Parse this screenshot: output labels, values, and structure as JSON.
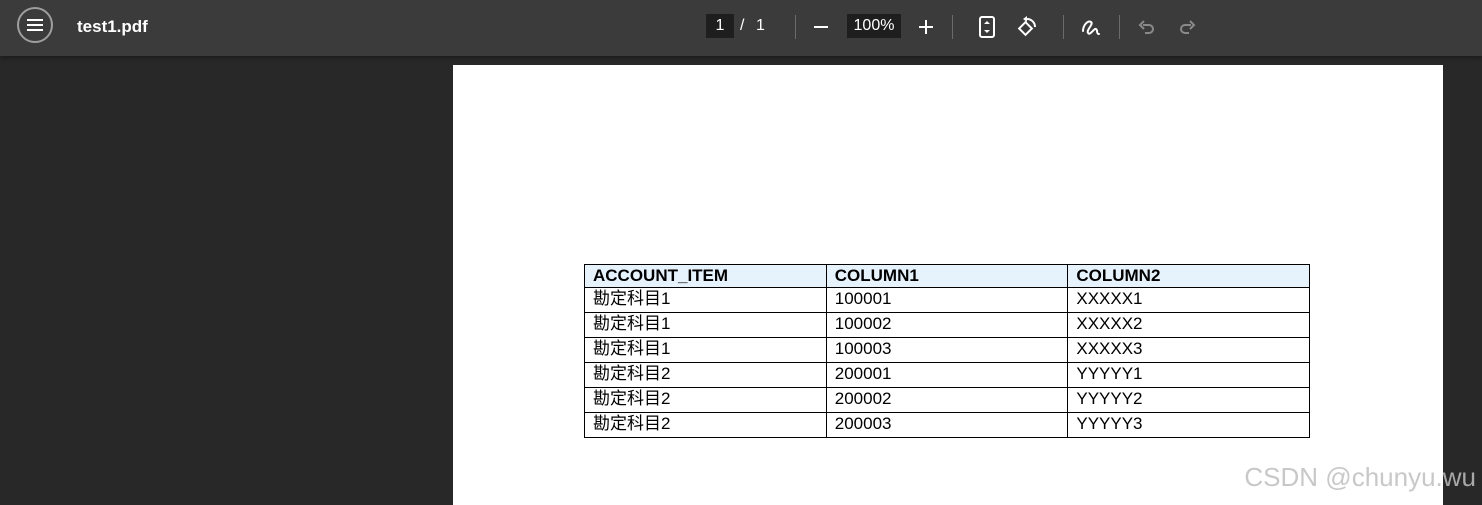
{
  "toolbar": {
    "title": "test1.pdf",
    "page_current": "1",
    "page_separator": "/",
    "page_total": "1",
    "zoom": "100%"
  },
  "icons": {
    "menu": "menu-icon",
    "zoom_out": "minus-icon",
    "zoom_in": "plus-icon",
    "fit": "fit-page-icon",
    "rotate": "rotate-icon",
    "annotate": "pen-icon",
    "undo": "undo-icon",
    "redo": "redo-icon"
  },
  "document": {
    "table": {
      "headers": [
        "ACCOUNT_ITEM",
        "COLUMN1",
        "COLUMN2"
      ],
      "rows": [
        [
          "勘定科目1",
          "100001",
          "XXXXX1"
        ],
        [
          "勘定科目1",
          "100002",
          "XXXXX2"
        ],
        [
          "勘定科目1",
          "100003",
          "XXXXX3"
        ],
        [
          "勘定科目2",
          "200001",
          "YYYYY1"
        ],
        [
          "勘定科目2",
          "200002",
          "YYYYY2"
        ],
        [
          "勘定科目2",
          "200003",
          "YYYYY3"
        ]
      ]
    }
  },
  "watermark": "CSDN @chunyu.wu",
  "colors": {
    "toolbar_bg": "#3b3b3b",
    "viewer_bg": "#282828",
    "header_fill": "#e6f2fc",
    "disabled_icon": "#8a8a8a"
  }
}
